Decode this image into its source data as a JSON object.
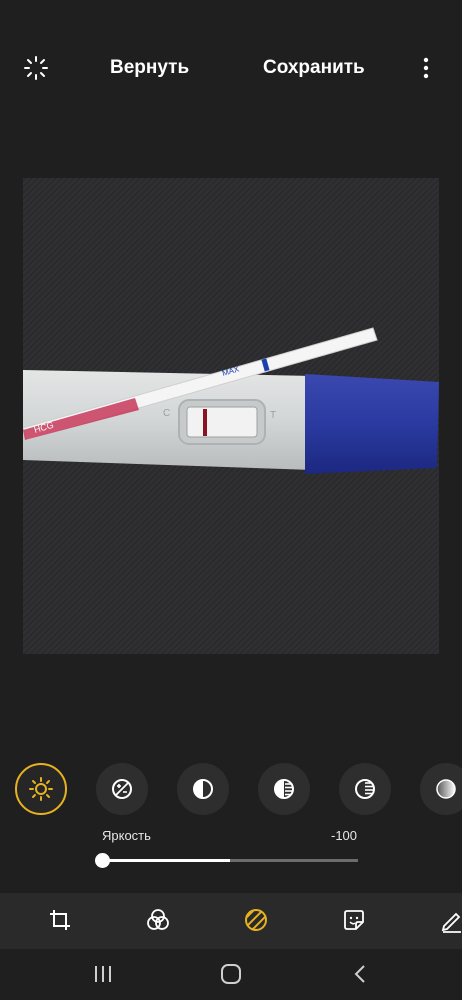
{
  "topbar": {
    "auto_icon": "auto-enhance-icon",
    "revert_label": "Вернуть",
    "save_label": "Сохранить",
    "more_icon": "more-vertical-icon"
  },
  "photo": {
    "device_label_left": "HCG",
    "strip_label": "MAX",
    "strip_label_2": "MAX"
  },
  "adjust_tools": [
    {
      "icon": "brightness-icon",
      "selected": true
    },
    {
      "icon": "exposure-icon",
      "selected": false
    },
    {
      "icon": "contrast-icon",
      "selected": false
    },
    {
      "icon": "highlights-icon",
      "selected": false
    },
    {
      "icon": "shadows-icon",
      "selected": false
    },
    {
      "icon": "saturation-icon",
      "selected": false
    }
  ],
  "slider": {
    "label": "Яркость",
    "value": "-100",
    "fill_fraction": 0.5
  },
  "bottom_tabs": [
    {
      "icon": "crop-rotate-icon"
    },
    {
      "icon": "filters-icon"
    },
    {
      "icon": "tone-icon",
      "active": true
    },
    {
      "icon": "sticker-icon"
    },
    {
      "icon": "draw-icon"
    }
  ],
  "navbar": {
    "recent_icon": "recent-apps-icon",
    "home_icon": "home-icon",
    "back_icon": "back-icon"
  },
  "colors": {
    "accent": "#e8b21f",
    "background": "#1f1f1f",
    "panel": "#2a2a2a"
  }
}
